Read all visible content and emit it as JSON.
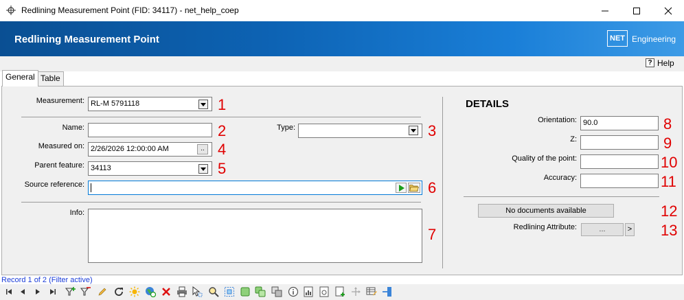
{
  "window": {
    "title": "Redlining Measurement Point (FID: 34117) - net_help_coep"
  },
  "banner": {
    "title": "Redlining Measurement Point",
    "logo_text": "NET",
    "brand_text": "Engineering"
  },
  "help": {
    "label": "Help"
  },
  "tabs": [
    {
      "label": "General",
      "active": true
    },
    {
      "label": "Table",
      "active": false
    }
  ],
  "form": {
    "measurement": {
      "label": "Measurement:",
      "value": "RL-M 5791118",
      "marker": "1"
    },
    "name": {
      "label": "Name:",
      "value": "",
      "marker": "2"
    },
    "type": {
      "label": "Type:",
      "value": "",
      "marker": "3"
    },
    "measured_on": {
      "label": "Measured on:",
      "value": "2/26/2026 12:00:00 AM",
      "button": "..",
      "marker": "4"
    },
    "parent_feature": {
      "label": "Parent feature:",
      "value": "34113",
      "marker": "5"
    },
    "source_reference": {
      "label": "Source reference:",
      "value": "",
      "marker": "6"
    },
    "info": {
      "label": "Info:",
      "value": "",
      "marker": "7"
    }
  },
  "details": {
    "heading": "DETAILS",
    "orientation": {
      "label": "Orientation:",
      "value": "90.0",
      "marker": "8"
    },
    "z": {
      "label": "Z:",
      "value": "",
      "marker": "9"
    },
    "quality": {
      "label": "Quality of the point:",
      "value": "",
      "marker": "10"
    },
    "accuracy": {
      "label": "Accuracy:",
      "value": "",
      "marker": "11"
    },
    "documents": {
      "label": "No documents available",
      "marker": "12"
    },
    "redlining_attribute": {
      "label": "Redlining Attribute:",
      "button": "...",
      "arrow": ">",
      "marker": "13"
    }
  },
  "status": {
    "record": "Record 1 of 2 (Filter active)"
  },
  "colors": {
    "banner": "#0d63b4",
    "marker": "#e00000",
    "record_text": "#1a3cd8"
  }
}
